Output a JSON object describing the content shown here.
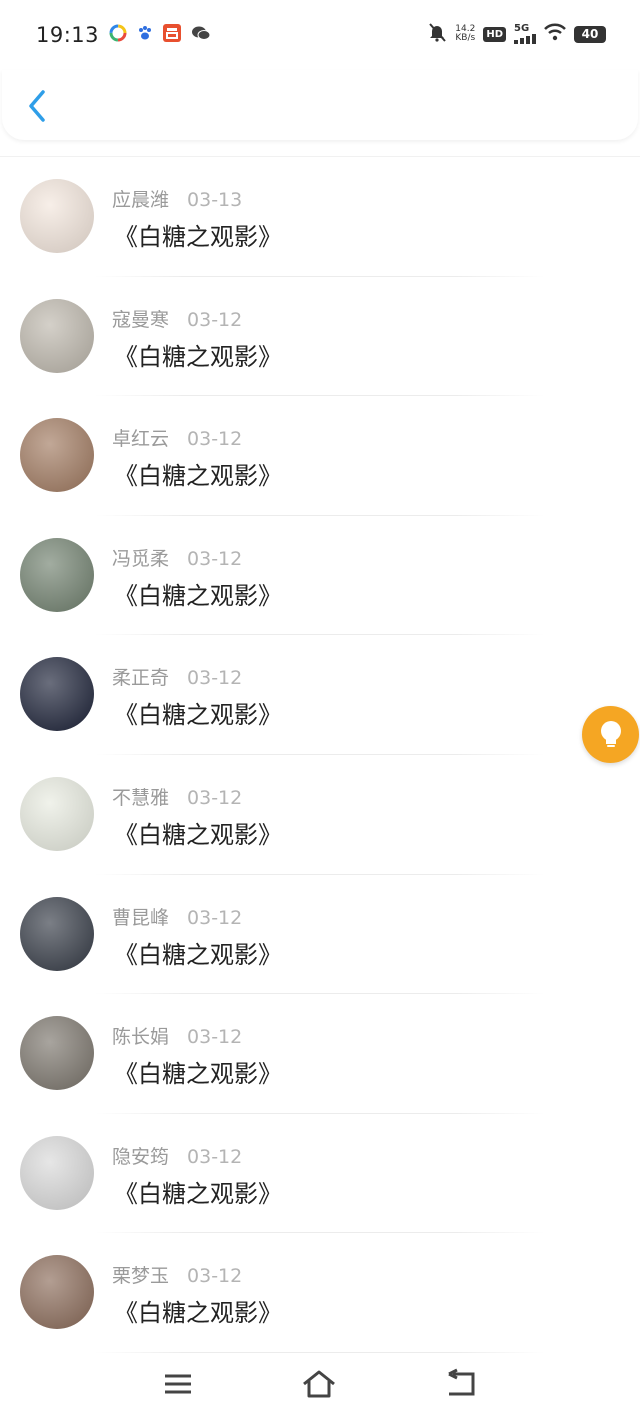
{
  "status_bar": {
    "time": "19:13",
    "app_icons": [
      "colorful-app-icon",
      "paw-icon",
      "red-app-icon",
      "wechat-icon"
    ],
    "net_speed_value": "14.2",
    "net_speed_unit": "KB/s",
    "hd": "HD",
    "network": "5G",
    "battery": "40"
  },
  "comments": [
    {
      "name": "应晨潍",
      "date": "03-13",
      "text": "《白糖之观影》",
      "avatar_color": "#f3e6dc"
    },
    {
      "name": "寇曼寒",
      "date": "03-12",
      "text": "《白糖之观影》",
      "avatar_color": "#bdb7ac"
    },
    {
      "name": "卓红云",
      "date": "03-12",
      "text": "《白糖之观影》",
      "avatar_color": "#a0795f"
    },
    {
      "name": "冯觅柔",
      "date": "03-12",
      "text": "《白糖之观影》",
      "avatar_color": "#70806e"
    },
    {
      "name": "柔正奇",
      "date": "03-12",
      "text": "《白糖之观影》",
      "avatar_color": "#1a2036"
    },
    {
      "name": "不慧雅",
      "date": "03-12",
      "text": "《白糖之观影》",
      "avatar_color": "#e8ebe0"
    },
    {
      "name": "曹昆峰",
      "date": "03-12",
      "text": "《白糖之观影》",
      "avatar_color": "#343a45"
    },
    {
      "name": "陈长娟",
      "date": "03-12",
      "text": "《白糖之观影》",
      "avatar_color": "#7a746b"
    },
    {
      "name": "隐安筠",
      "date": "03-12",
      "text": "《白糖之观影》",
      "avatar_color": "#d9d9d9"
    },
    {
      "name": "栗梦玉",
      "date": "03-12",
      "text": "《白糖之观影》",
      "avatar_color": "#8a6a58"
    }
  ],
  "colors": {
    "accent_back": "#2f9ee8",
    "fab": "#f5a623"
  }
}
